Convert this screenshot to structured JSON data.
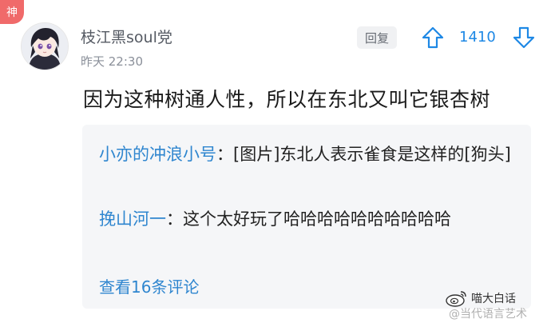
{
  "badge": "神",
  "user": {
    "name": "枝江黑soul党",
    "time": "昨天 22:30"
  },
  "actions": {
    "reply_label": "回复",
    "vote_count": "1410"
  },
  "comment": {
    "text": "因为这种树通人性，所以在东北又叫它银杏树"
  },
  "replies": [
    {
      "name": "小亦的冲浪小号",
      "text": "：[图片]东北人表示雀食是这样的[狗头]"
    },
    {
      "name": "挽山河一",
      "text": "：这个太好玩了哈哈哈哈哈哈哈哈哈哈"
    }
  ],
  "view_more": "查看16条评论",
  "watermark": {
    "title": "喵大白话",
    "subtitle": "@当代语言艺术"
  },
  "colors": {
    "link": "#2f86cf",
    "vote": "#1e88e5",
    "badge": "#f06a6a"
  }
}
